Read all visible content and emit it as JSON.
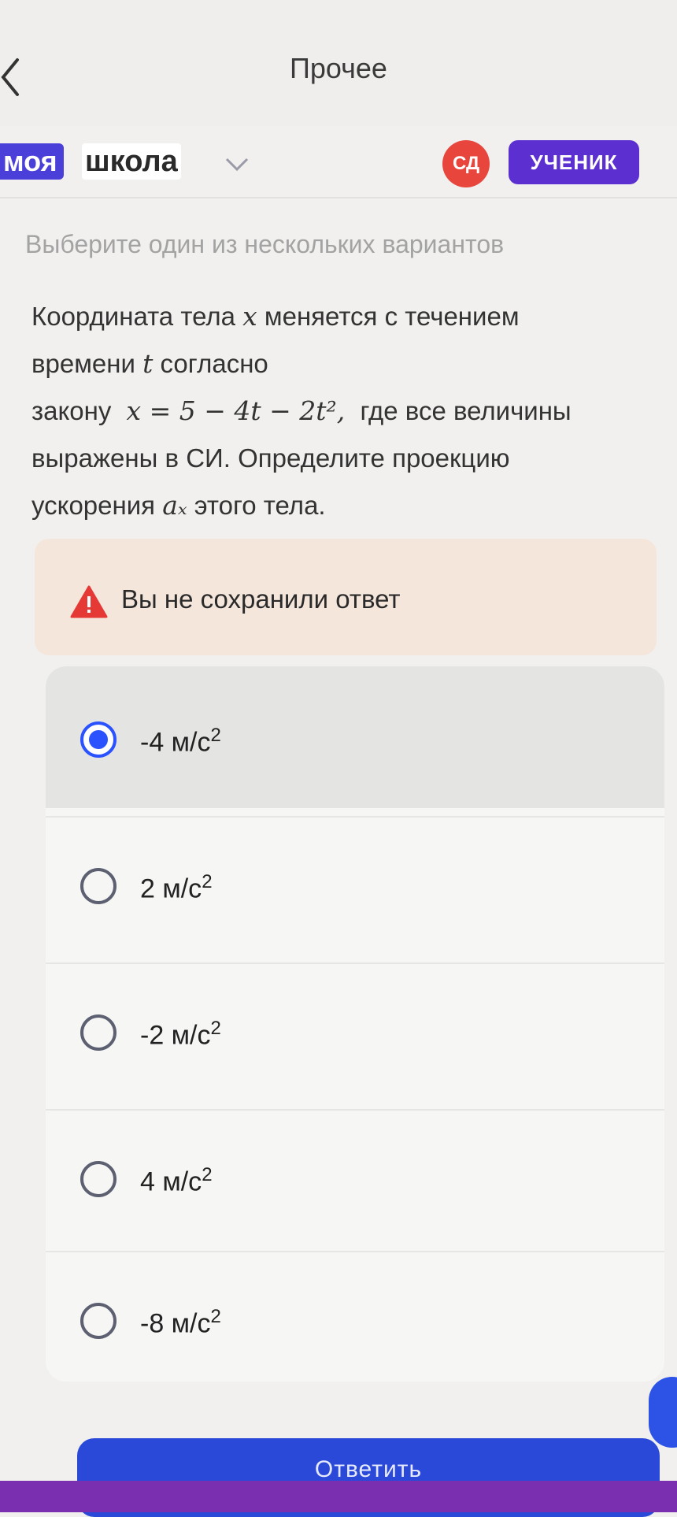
{
  "header": {
    "title": "Прочее"
  },
  "brand": {
    "word1": "моя",
    "word2": "школа"
  },
  "user": {
    "initials": "СД",
    "role": "УЧЕНИК"
  },
  "task": {
    "instruction": "Выберите один из нескольких вариантов",
    "q_part1": "Координата тела",
    "q_var_x": "x",
    "q_part2": "меняется с течением",
    "q_part3": "времени",
    "q_var_t": "t",
    "q_part4": "согласно",
    "q_part5": "закону",
    "q_formula": "x = 5 − 4t − 2t²,",
    "q_part6": "где все величины",
    "q_part7": "выражены в СИ. Определите проекцию",
    "q_part8": "ускорения",
    "q_var_ax": "aₓ",
    "q_part9": "этого тела."
  },
  "warning": {
    "text": "Вы не сохранили ответ"
  },
  "options": [
    {
      "value": "-4 м/с",
      "exp": "2",
      "selected": true
    },
    {
      "value": "2 м/с",
      "exp": "2",
      "selected": false
    },
    {
      "value": "-2 м/с",
      "exp": "2",
      "selected": false
    },
    {
      "value": "4 м/с",
      "exp": "2",
      "selected": false
    },
    {
      "value": "-8 м/с",
      "exp": "2",
      "selected": false
    }
  ],
  "submit": {
    "label": "Ответить"
  },
  "colors": {
    "accent": "#2a52ff",
    "brand": "#4a3fd8",
    "role_badge": "#5b2fd0",
    "avatar": "#e8453c",
    "warning_bg": "#f5e6dc",
    "alert": "#e53935"
  }
}
